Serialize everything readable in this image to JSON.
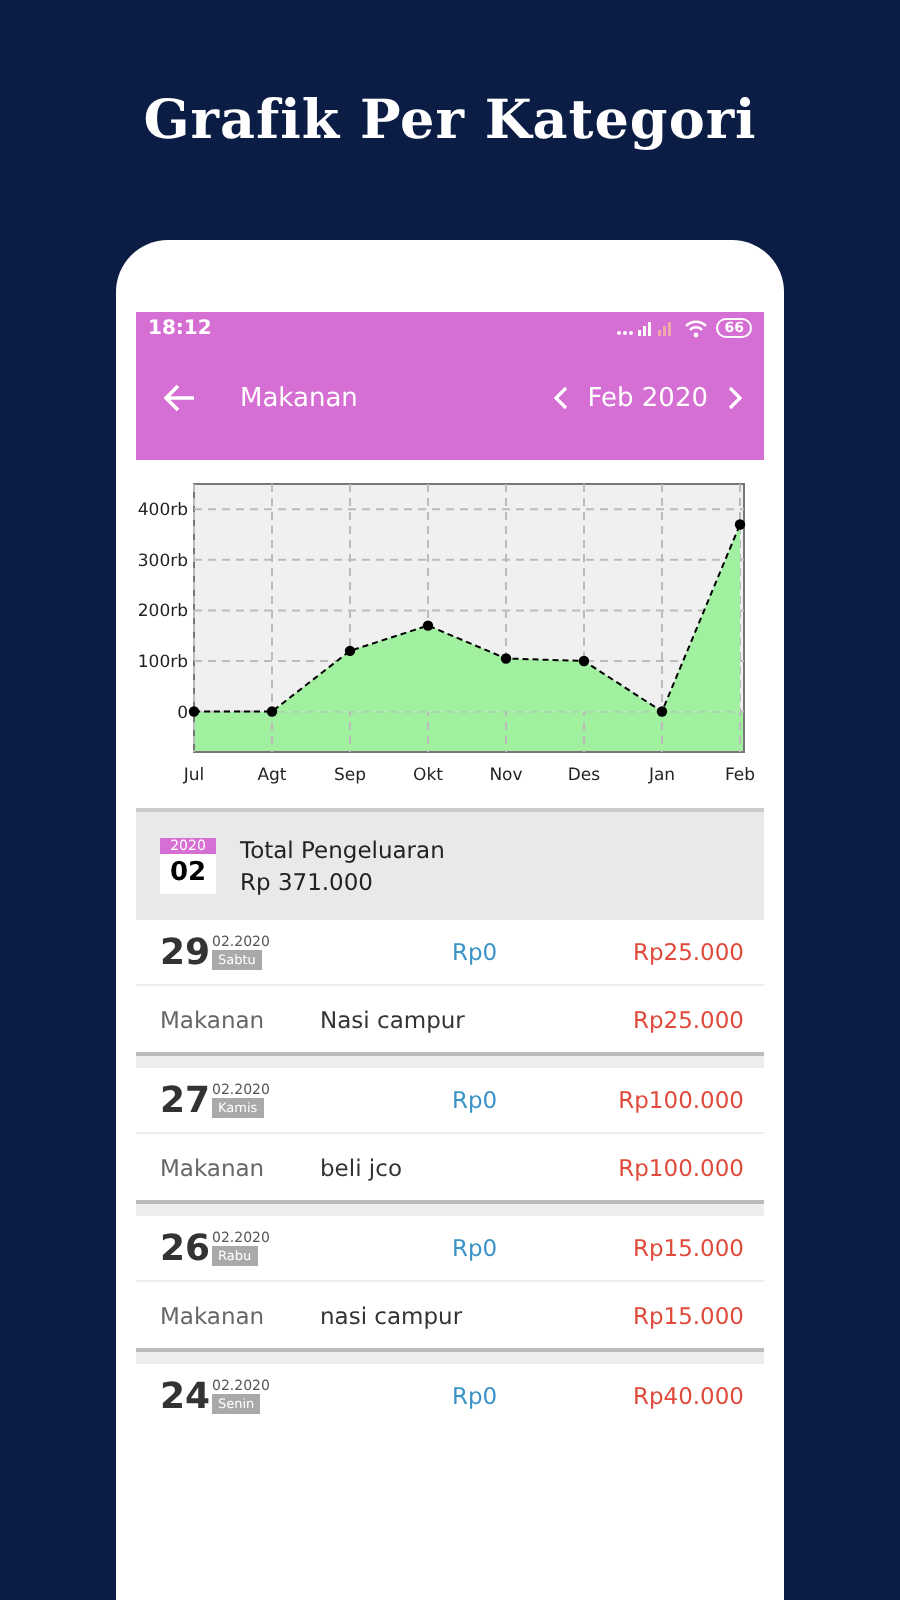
{
  "banner": {
    "title": "Grafik Per Kategori"
  },
  "status_bar": {
    "time": "18:12",
    "battery": "66"
  },
  "app_bar": {
    "title": "Makanan",
    "period": "Feb 2020"
  },
  "chart_data": {
    "type": "area",
    "categories": [
      "Jul",
      "Agt",
      "Sep",
      "Okt",
      "Nov",
      "Des",
      "Jan",
      "Feb"
    ],
    "grid": true,
    "series": [
      {
        "color": "#a0f0a0",
        "values": [
          0,
          0,
          120,
          170,
          105,
          100,
          0,
          370
        ]
      }
    ],
    "ylim": [
      -80,
      450
    ],
    "yticks": [
      {
        "value": 0,
        "label": "0"
      },
      {
        "value": 100,
        "label": "100rb"
      },
      {
        "value": 200,
        "label": "200rb"
      },
      {
        "value": 300,
        "label": "300rb"
      },
      {
        "value": 400,
        "label": "400rb"
      }
    ]
  },
  "summary": {
    "year": "2020",
    "month": "02",
    "label": "Total Pengeluaran",
    "total": "Rp 371.000"
  },
  "days": [
    {
      "day": "29",
      "month_year": "02.2020",
      "weekday": "Sabtu",
      "income": "Rp0",
      "expense": "Rp25.000",
      "entries": [
        {
          "category": "Makanan",
          "note": "Nasi campur",
          "amount": "Rp25.000"
        }
      ]
    },
    {
      "day": "27",
      "month_year": "02.2020",
      "weekday": "Kamis",
      "income": "Rp0",
      "expense": "Rp100.000",
      "entries": [
        {
          "category": "Makanan",
          "note": "beli jco",
          "amount": "Rp100.000"
        }
      ]
    },
    {
      "day": "26",
      "month_year": "02.2020",
      "weekday": "Rabu",
      "income": "Rp0",
      "expense": "Rp15.000",
      "entries": [
        {
          "category": "Makanan",
          "note": "nasi campur",
          "amount": "Rp15.000"
        }
      ]
    },
    {
      "day": "24",
      "month_year": "02.2020",
      "weekday": "Senin",
      "income": "Rp0",
      "expense": "Rp40.000"
    }
  ]
}
